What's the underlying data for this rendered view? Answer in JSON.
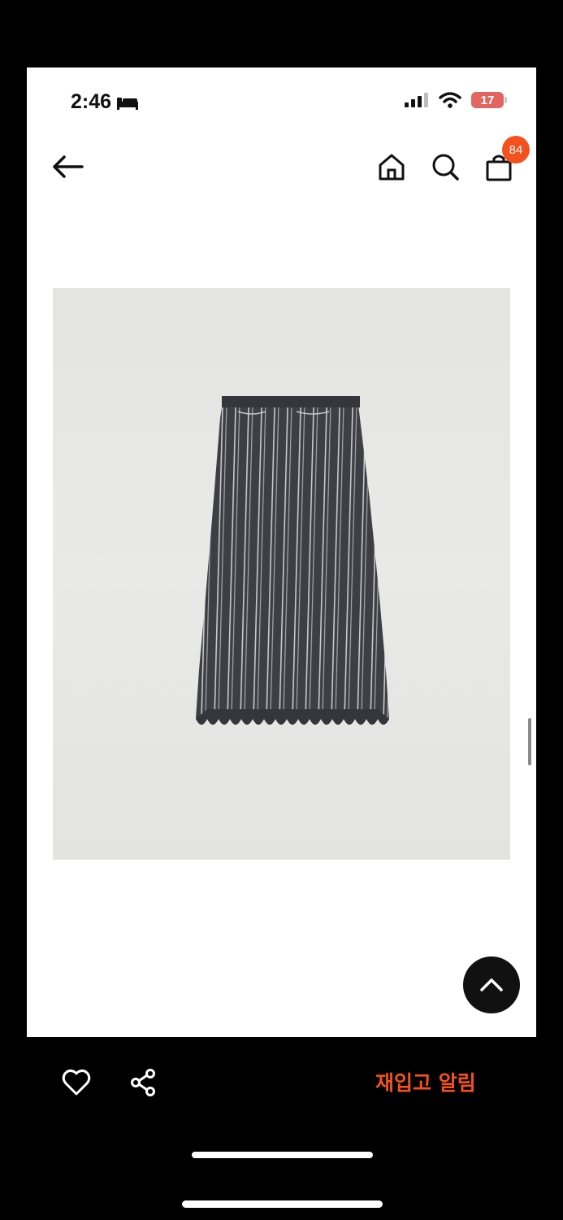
{
  "status_bar": {
    "time": "2:46",
    "battery": "17",
    "icons": [
      "bed-icon",
      "signal-icon",
      "wifi-icon",
      "battery-icon"
    ]
  },
  "nav": {
    "icons": [
      "back-arrow-icon",
      "home-icon",
      "search-icon",
      "shopping-bag-icon"
    ],
    "cart_count": "84"
  },
  "product": {
    "image_subject": "striped-skirt",
    "colors": {
      "skirt": "#3d3f44",
      "stripe": "#c9c9cc",
      "background": "#e6e6e4"
    }
  },
  "actions": {
    "restock_label": "재입고 알림",
    "icons": [
      "heart-icon",
      "share-icon",
      "chevron-up-icon"
    ]
  },
  "colors": {
    "accent": "#f4511e",
    "badge": "#f4511e",
    "battery_low": "#e0665f"
  }
}
